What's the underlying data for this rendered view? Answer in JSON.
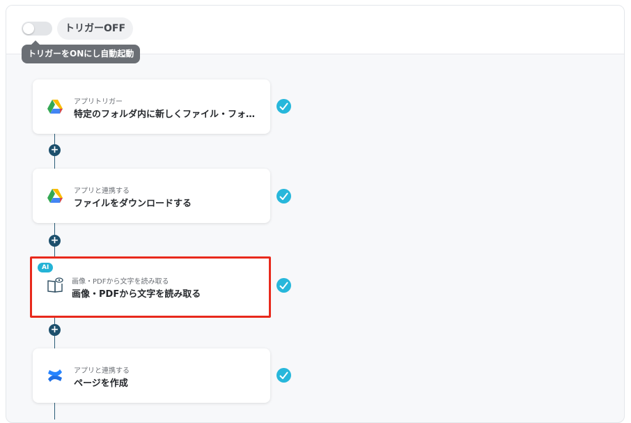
{
  "trigger": {
    "status_label": "トリガーOFF",
    "tooltip": "トリガーをONにし自動起動"
  },
  "steps": [
    {
      "subtitle": "アプリトリガー",
      "title": "特定のフォルダ内に新しくファイル・フォ…",
      "icon": "google-drive-icon",
      "done": true
    },
    {
      "subtitle": "アプリと連携する",
      "title": "ファイルをダウンロードする",
      "icon": "google-drive-icon",
      "done": true
    },
    {
      "badge": "AI",
      "subtitle": "画像・PDFから文字を読み取る",
      "title": "画像・PDFから文字を読み取る",
      "icon": "ocr-book-icon",
      "done": true
    },
    {
      "subtitle": "アプリと連携する",
      "title": "ページを作成",
      "icon": "confluence-icon",
      "done": true
    }
  ],
  "add_step_label": "+",
  "colors": {
    "accent": "#27b7db",
    "connector": "#1d506d",
    "highlight": "#e8291c"
  }
}
